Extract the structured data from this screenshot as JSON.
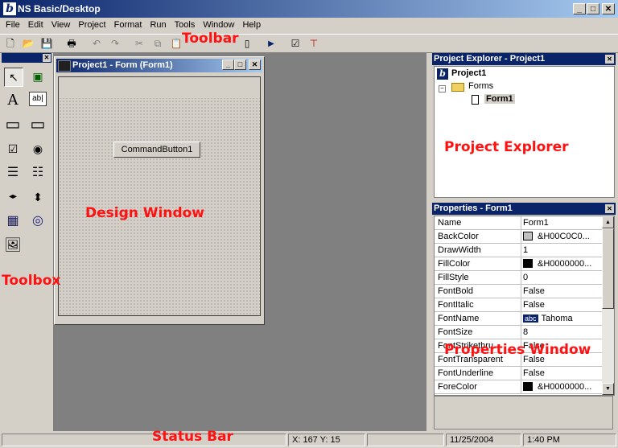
{
  "app": {
    "title": "NS Basic/Desktop",
    "icon_letter": "b",
    "controls": {
      "minimize": "_",
      "maximize": "□",
      "close": "✕"
    }
  },
  "menu": [
    "File",
    "Edit",
    "View",
    "Project",
    "Format",
    "Run",
    "Tools",
    "Window",
    "Help"
  ],
  "toolbar": {
    "buttons": [
      {
        "name": "new-icon",
        "glyph": "🗋"
      },
      {
        "name": "open-icon",
        "glyph": "📂"
      },
      {
        "name": "save-icon",
        "glyph": "💾"
      },
      {
        "name": "print-icon",
        "glyph": "🖶"
      },
      {
        "name": "undo-icon",
        "glyph": "↶"
      },
      {
        "name": "redo-icon",
        "glyph": "↷"
      },
      {
        "name": "cut-icon",
        "glyph": "✂"
      },
      {
        "name": "copy-icon",
        "glyph": "⧉"
      },
      {
        "name": "paste-icon",
        "glyph": "📋"
      },
      {
        "name": "form-icon",
        "glyph": "▯"
      },
      {
        "name": "run-icon",
        "glyph": "▶"
      },
      {
        "name": "properties-icon",
        "glyph": "☑"
      },
      {
        "name": "toolbox-icon",
        "glyph": "⊤"
      }
    ]
  },
  "toolbox": {
    "tools": [
      {
        "name": "pointer-tool-icon",
        "glyph": "↖"
      },
      {
        "name": "picture-tool-icon",
        "glyph": "▣"
      },
      {
        "name": "label-tool-icon",
        "glyph": "A"
      },
      {
        "name": "textbox-tool-icon",
        "glyph": "ab|"
      },
      {
        "name": "frame-tool-icon",
        "glyph": "▭"
      },
      {
        "name": "commandbutton-tool-icon",
        "glyph": "▭"
      },
      {
        "name": "checkbox-tool-icon",
        "glyph": "☑"
      },
      {
        "name": "optionbutton-tool-icon",
        "glyph": "◉"
      },
      {
        "name": "combobox-tool-icon",
        "glyph": "☰"
      },
      {
        "name": "listbox-tool-icon",
        "glyph": "☷"
      },
      {
        "name": "hscrollbar-tool-icon",
        "glyph": "◂▸"
      },
      {
        "name": "vscrollbar-tool-icon",
        "glyph": "⬍"
      },
      {
        "name": "grid-tool-icon",
        "glyph": "▦"
      },
      {
        "name": "timer-tool-icon",
        "glyph": "◎"
      },
      {
        "name": "custom-tool-icon",
        "glyph": "🖼"
      }
    ]
  },
  "form_window": {
    "title": "Project1 - Form (Form1)",
    "command_button": "CommandButton1"
  },
  "project_explorer": {
    "title": "Project Explorer - Project1",
    "root": "Project1",
    "folder": "Forms",
    "form": "Form1"
  },
  "properties": {
    "title": "Properties - Form1",
    "rows": [
      {
        "name": "Name",
        "value": "Form1",
        "swatch": ""
      },
      {
        "name": "BackColor",
        "value": "&H00C0C0...",
        "swatch": "#c0c0c0"
      },
      {
        "name": "DrawWidth",
        "value": "1",
        "swatch": ""
      },
      {
        "name": "FillColor",
        "value": "&H0000000...",
        "swatch": "#000000"
      },
      {
        "name": "FillStyle",
        "value": "0",
        "swatch": ""
      },
      {
        "name": "FontBold",
        "value": "False",
        "swatch": ""
      },
      {
        "name": "FontItalic",
        "value": "False",
        "swatch": ""
      },
      {
        "name": "FontName",
        "value": "Tahoma",
        "swatch": "",
        "font_badge": "abc"
      },
      {
        "name": "FontSize",
        "value": "8",
        "swatch": ""
      },
      {
        "name": "FontStrikethru",
        "value": "False",
        "swatch": ""
      },
      {
        "name": "FontTransparent",
        "value": "False",
        "swatch": ""
      },
      {
        "name": "FontUnderline",
        "value": "False",
        "swatch": ""
      },
      {
        "name": "ForeColor",
        "value": "&H0000000...",
        "swatch": "#000000"
      }
    ]
  },
  "statusbar": {
    "coords": "X: 167  Y: 15",
    "date": "11/25/2004",
    "time": "1:40 PM"
  },
  "annotations": {
    "toolbar": "Toolbar",
    "toolbox": "Toolbox",
    "design_window": "Design Window",
    "project_explorer": "Project Explorer",
    "properties_window": "Properties Window",
    "status_bar": "Status Bar"
  },
  "colors": {
    "title_active": "#0a246a",
    "title_gradient_end": "#a6caf0",
    "face": "#d4d0c8",
    "mdi_background": "#808080",
    "annotation": "#ff1111"
  }
}
